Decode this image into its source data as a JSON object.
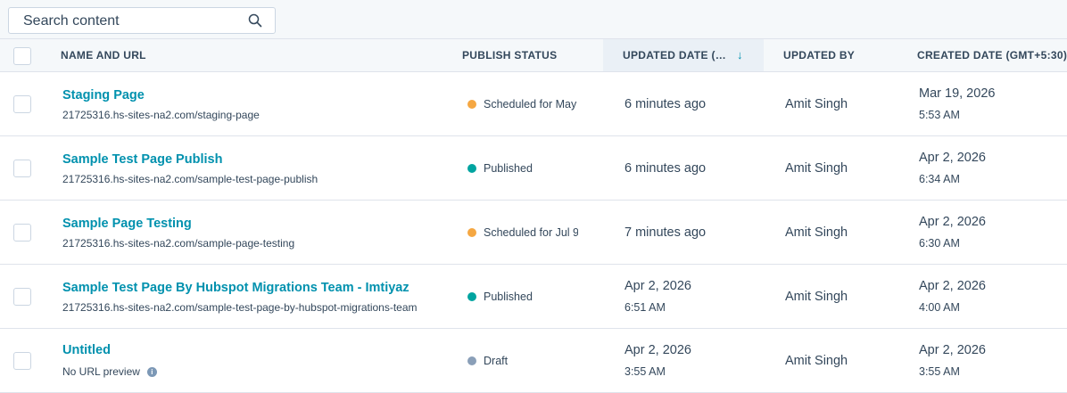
{
  "search": {
    "placeholder": "Search content",
    "icon": "search-icon"
  },
  "columns": {
    "name": "NAME AND URL",
    "status": "PUBLISH STATUS",
    "updated_date": "UPDATED DATE (…",
    "updated_by": "UPDATED BY",
    "created_date": "CREATED DATE (GMT+5:30)"
  },
  "sort": {
    "arrow": "↓"
  },
  "status_colors": {
    "scheduled": "#f5a742",
    "published": "#00a4a0",
    "draft": "#8a9fb8"
  },
  "rows": [
    {
      "title": "Staging Page",
      "url": "21725316.hs-sites-na2.com/staging-page",
      "status": "Scheduled for May",
      "updated": "6 minutes ago",
      "updated_by": "Amit Singh",
      "created_date": "Mar 19, 2026",
      "created_time": "5:53 AM"
    },
    {
      "title": "Sample Test Page Publish",
      "url": "21725316.hs-sites-na2.com/sample-test-page-publish",
      "status": "Published",
      "updated": "6 minutes ago",
      "updated_by": "Amit Singh",
      "created_date": "Apr 2, 2026",
      "created_time": "6:34 AM"
    },
    {
      "title": "Sample Page Testing",
      "url": "21725316.hs-sites-na2.com/sample-page-testing",
      "status": "Scheduled for Jul 9",
      "updated": "7 minutes ago",
      "updated_by": "Amit Singh",
      "created_date": "Apr 2, 2026",
      "created_time": "6:30 AM"
    },
    {
      "title": "Sample Test Page By Hubspot Migrations Team - Imtiyaz",
      "url": "21725316.hs-sites-na2.com/sample-test-page-by-hubspot-migrations-team",
      "status": "Published",
      "updated_date": "Apr 2, 2026",
      "updated_time": "6:51 AM",
      "updated_by": "Amit Singh",
      "created_date": "Apr 2, 2026",
      "created_time": "4:00 AM"
    },
    {
      "title": "Untitled",
      "url": "No URL preview",
      "status": "Draft",
      "updated_date": "Apr 2, 2026",
      "updated_time": "3:55 AM",
      "updated_by": "Amit Singh",
      "created_date": "Apr 2, 2026",
      "created_time": "3:55 AM"
    }
  ]
}
